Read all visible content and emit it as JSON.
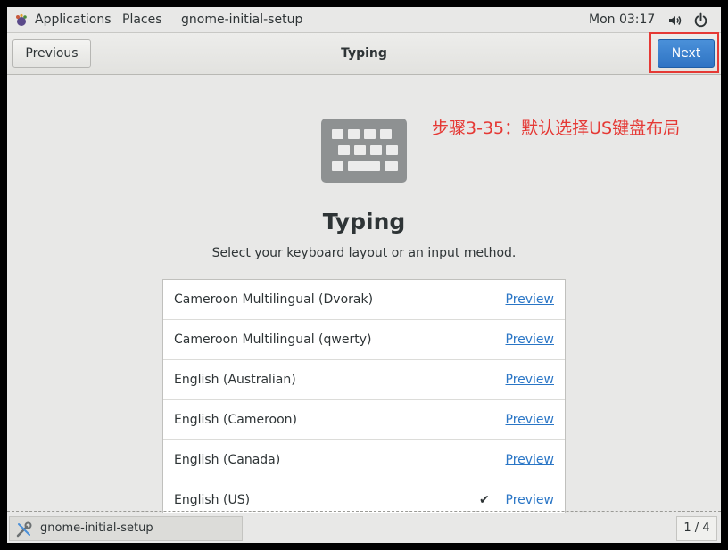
{
  "topbar": {
    "applications_label": "Applications",
    "places_label": "Places",
    "app_name": "gnome-initial-setup",
    "clock": "Mon 03:17"
  },
  "header": {
    "previous_label": "Previous",
    "title": "Typing",
    "next_label": "Next"
  },
  "annotation": "步骤3-35：默认选择US键盘布局",
  "page": {
    "title": "Typing",
    "subtitle": "Select your keyboard layout or an input method."
  },
  "layouts": [
    {
      "name": "Cameroon Multilingual (Dvorak)",
      "preview": "Preview"
    },
    {
      "name": "Cameroon Multilingual (qwerty)",
      "preview": "Preview"
    },
    {
      "name": "English (Australian)",
      "preview": "Preview"
    },
    {
      "name": "English (Cameroon)",
      "preview": "Preview"
    },
    {
      "name": "English (Canada)",
      "preview": "Preview"
    },
    {
      "name": "English (US)",
      "preview": "Preview",
      "check": "✔"
    }
  ],
  "taskbar": {
    "window_label": "gnome-initial-setup",
    "workspace": "1 / 4"
  },
  "colors": {
    "accent": "#2f74c4",
    "annotation": "#e53935",
    "link": "#2a76c6"
  }
}
